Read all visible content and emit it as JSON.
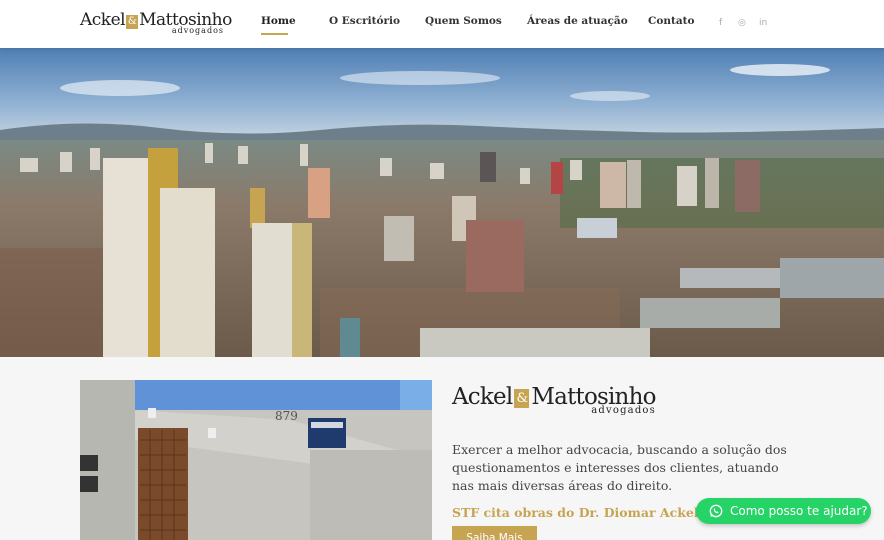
{
  "header": {
    "logo": {
      "left": "Ackel",
      "amp": "&",
      "right": "Mattosinho",
      "sub": "advogados"
    },
    "nav": [
      {
        "label": "Home",
        "active": true
      },
      {
        "label": "O Escritório"
      },
      {
        "label": "Quem Somos"
      },
      {
        "label": "Áreas de atuação"
      },
      {
        "label": "Contato"
      }
    ],
    "social": [
      "facebook-icon",
      "instagram-icon",
      "linkedin-icon"
    ],
    "social_glyphs": {
      "facebook": "f",
      "instagram": "◎",
      "linkedin": "in"
    }
  },
  "hero": {
    "image": "city-panorama"
  },
  "intro": {
    "photo": {
      "image": "office-building-entrance",
      "building_number": "879"
    },
    "logo": {
      "left": "Ackel",
      "amp": "&",
      "right": "Mattosinho",
      "sub": "advogados"
    },
    "description": "Exercer a melhor advocacia, buscando a solução dos questionamentos e interesses dos clientes, atuando nas mais diversas áreas do direito.",
    "news_link": "STF cita obras do Dr. Diomar Ackel em suas",
    "more_button": "Saiba Mais"
  },
  "whatsapp": {
    "label": "Como posso te ajudar?",
    "icon": "whatsapp-icon"
  },
  "colors": {
    "accent": "#c7a452",
    "whatsapp": "#25d366"
  }
}
